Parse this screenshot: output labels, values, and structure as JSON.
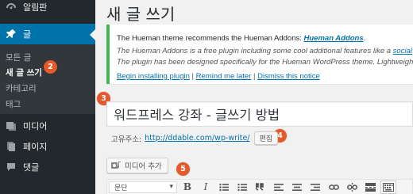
{
  "sidebar": {
    "dashboard_label": "알림판",
    "posts_label": "글",
    "submenu": {
      "all_posts": "모든 글",
      "add_new": "새 글 쓰기",
      "categories": "카테고리",
      "tags": "태그"
    },
    "media_label": "미디어",
    "pages_label": "페이지",
    "comments_label": "댓글"
  },
  "callouts": [
    "2",
    "3",
    "4",
    "5"
  ],
  "page": {
    "title": "새 글 쓰기"
  },
  "notice": {
    "line1_text": "The Hueman theme recommends the Hueman Addons: ",
    "line1_link": "Hueman Addons",
    "line1_end": ".",
    "line2_text": "The Hueman Addons is a free plugin including some cool additional features like a ",
    "line2_link": "social",
    "line3_text": "The plugin has been designed specifically for the Hueman WordPress theme. Lightweight",
    "actions": {
      "begin_install": "Begin installing plugin",
      "remind_later": "Remind me later",
      "dismiss": "Dismiss this notice",
      "separator": " | "
    }
  },
  "editor": {
    "post_title": "워드프레스 강좌 - 글쓰기 방법",
    "permalink_label": "고유주소:",
    "permalink_url": "http://ddable.com/wp-write/",
    "edit_button": "편집",
    "add_media_button": "미디어 추가",
    "format_select": "문단"
  },
  "icons": {
    "dashboard": "dashboard-icon",
    "posts": "pin-icon",
    "media": "media-icon",
    "pages": "pages-icon",
    "comments": "comments-icon"
  },
  "colors": {
    "sidebar_bg": "#23282d",
    "active_menu": "#0073aa",
    "notice_border": "#46b450",
    "link": "#0073aa",
    "callout": "#e55a2b"
  }
}
